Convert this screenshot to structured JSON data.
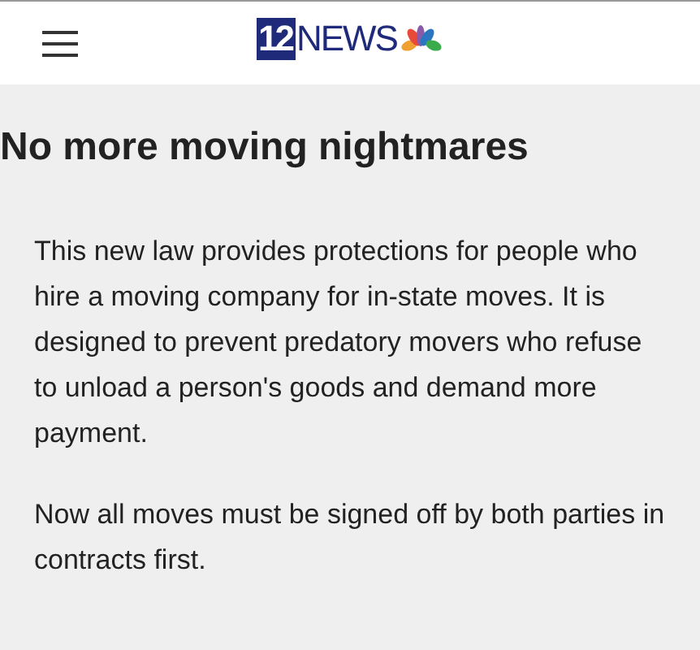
{
  "header": {
    "logo_number": "12",
    "logo_text": "NEWS"
  },
  "article": {
    "title": "No more moving nightmares",
    "paragraphs": [
      "This new law provides protections for people who hire a moving company for in-state moves. It is designed to prevent predatory movers who refuse to unload a person's goods and demand more payment.",
      "Now all moves must be signed off by both parties in contracts first."
    ]
  }
}
